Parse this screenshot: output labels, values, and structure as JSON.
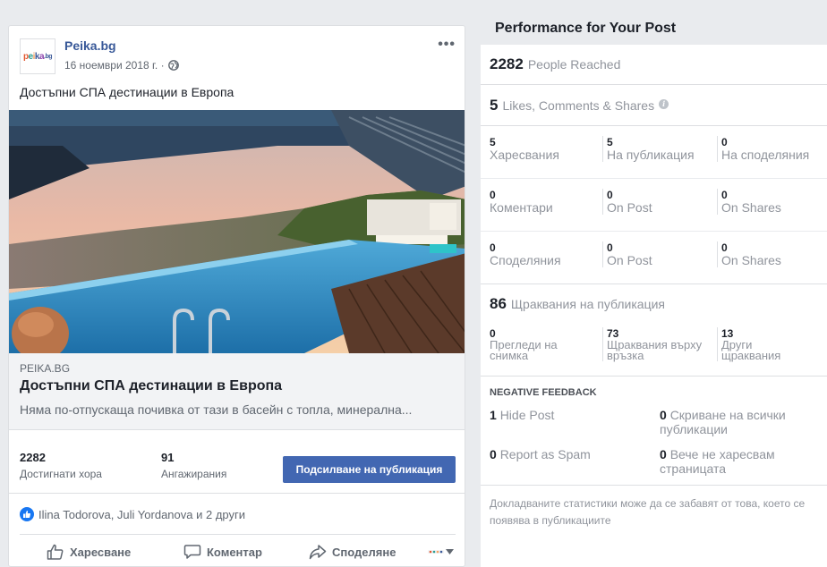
{
  "post": {
    "page_name": "Peika.bg",
    "logo_text": [
      "p",
      "e",
      "i",
      "k",
      "a"
    ],
    "logo_suffix": ".bg",
    "date": "16 ноември 2018 г. ·",
    "more_label": "•••",
    "text": "Достъпни СПА дестинации в Европа",
    "link": {
      "domain": "PEIKA.BG",
      "title": "Достъпни СПА дестинации в Европа",
      "description": "Няма по-отпускаща почивка от тази в басейн с топла, минерална..."
    },
    "stats": {
      "reach_num": "2282",
      "reach_label": "Достигнати хора",
      "engage_num": "91",
      "engage_label": "Ангажирания",
      "boost_label": "Подсилване на публикация"
    },
    "reactors": "Ilina Todorova, Juli Yordanova и 2 други",
    "actions": {
      "like": "Харесване",
      "comment": "Коментар",
      "share": "Споделяне"
    }
  },
  "performance": {
    "title": "Performance for Your Post",
    "reach": {
      "num": "2282",
      "label": "People Reached"
    },
    "engagement": {
      "num": "5",
      "label": "Likes, Comments & Shares"
    },
    "rows": [
      {
        "c1": {
          "num": "5",
          "label": "Харесвания"
        },
        "c2": {
          "num": "5",
          "label": "На публикация"
        },
        "c3": {
          "num": "0",
          "label": "На споделяния"
        }
      },
      {
        "c1": {
          "num": "0",
          "label": "Коментари"
        },
        "c2": {
          "num": "0",
          "label": "On Post"
        },
        "c3": {
          "num": "0",
          "label": "On Shares"
        }
      },
      {
        "c1": {
          "num": "0",
          "label": "Споделяния"
        },
        "c2": {
          "num": "0",
          "label": "On Post"
        },
        "c3": {
          "num": "0",
          "label": "On Shares"
        }
      }
    ],
    "clicks": {
      "num": "86",
      "label": "Щраквания на публикация"
    },
    "click_row": {
      "c1": {
        "num": "0",
        "l1": "Прегледи на",
        "l2": "снимка"
      },
      "c2": {
        "num": "73",
        "l1": "Щраквания върху",
        "l2": "връзка"
      },
      "c3": {
        "num": "13",
        "l1": "Други",
        "l2": "щраквания"
      }
    },
    "negative": {
      "title": "NEGATIVE FEEDBACK",
      "hide_post_num": "1",
      "hide_post": "Hide Post",
      "hide_all_num": "0",
      "hide_all_l1": "Скриване на всички",
      "hide_all_l2": "публикации",
      "spam_num": "0",
      "spam": "Report as Spam",
      "unlike_num": "0",
      "unlike_l1": "Вече не харесвам",
      "unlike_l2": "страницата"
    },
    "disclaimer_l1": "Докладваните статистики може да се забавят от това, което се",
    "disclaimer_l2": "появява в публикациите"
  }
}
